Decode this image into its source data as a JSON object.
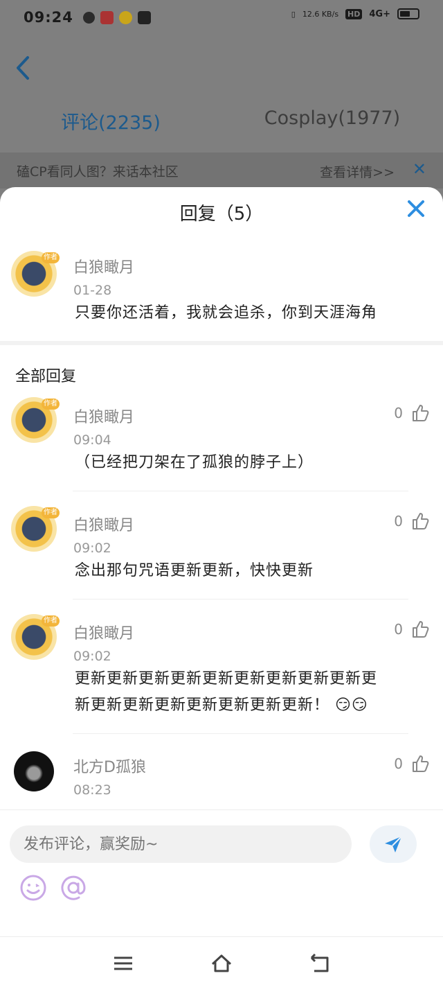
{
  "status_bar": {
    "time": "09:24",
    "net_speed": "12.6 KB/s",
    "hd": "HD",
    "signal": "4G+"
  },
  "background_page": {
    "tabs": [
      "评论(2235)",
      "Cosplay(1977)"
    ],
    "banner_text": "磕CP看同人图？来话本社区",
    "banner_link": "查看详情>>"
  },
  "sheet": {
    "title": "回复（5）",
    "original": {
      "author": "白狼瞰月",
      "badge": "作者",
      "date": "01-28",
      "text": "只要你还活着，我就会追杀，你到天涯海角"
    },
    "section_label": "全部回复",
    "replies": [
      {
        "author": "白狼瞰月",
        "badge": "作者",
        "time": "09:04",
        "text": "（已经把刀架在了孤狼的脖子上）",
        "likes": "0"
      },
      {
        "author": "白狼瞰月",
        "badge": "作者",
        "time": "09:02",
        "text": "念出那句咒语更新更新，快快更新",
        "likes": "0"
      },
      {
        "author": "白狼瞰月",
        "badge": "作者",
        "time": "09:02",
        "text_line1": "更新更新更新更新更新更新更新更新更新更",
        "text_line2": "新更新更新更新更新更新更新更新！ 😏😏",
        "likes": "0"
      },
      {
        "author": "北方D孤狼",
        "time": "08:23",
        "likes": "0"
      }
    ]
  },
  "input": {
    "placeholder": "发布评论，赢奖励~"
  },
  "colors": {
    "accent": "#2d8ee0",
    "overlay": "#7f7f7f"
  }
}
